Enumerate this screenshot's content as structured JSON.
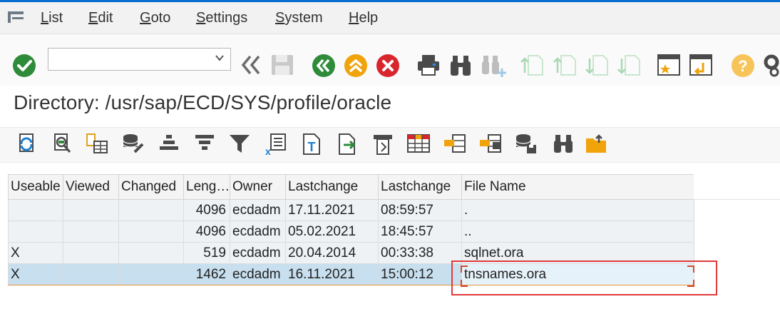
{
  "menu": {
    "items": [
      {
        "label": "List",
        "underline": "L",
        "rest": "ist"
      },
      {
        "label": "Edit",
        "underline": "E",
        "rest": "dit"
      },
      {
        "label": "Goto",
        "underline": "G",
        "rest": "oto"
      },
      {
        "label": "Settings",
        "underline": "S",
        "rest": "ettings"
      },
      {
        "label": "System",
        "underline": "S",
        "rest": "ystem"
      },
      {
        "label": "Help",
        "underline": "H",
        "rest": "elp"
      }
    ]
  },
  "command_field": {
    "value": "",
    "placeholder": ""
  },
  "title": "Directory: /usr/sap/ECD/SYS/profile/oracle",
  "table": {
    "headers": [
      "Useable",
      "Viewed",
      "Changed",
      "Leng…",
      "Owner",
      "Lastchange",
      "Lastchange",
      "File Name"
    ],
    "rows": [
      {
        "useable": "",
        "viewed": "",
        "changed": "",
        "length": "4096",
        "owner": "ecdadm",
        "date": "17.11.2021",
        "time": "08:59:57",
        "filename": "."
      },
      {
        "useable": "",
        "viewed": "",
        "changed": "",
        "length": "4096",
        "owner": "ecdadm",
        "date": "05.02.2021",
        "time": "18:45:57",
        "filename": ".."
      },
      {
        "useable": "X",
        "viewed": "",
        "changed": "",
        "length": "519",
        "owner": "ecdadm",
        "date": "20.04.2014",
        "time": "00:33:38",
        "filename": "sqlnet.ora"
      },
      {
        "useable": "X",
        "viewed": "",
        "changed": "",
        "length": "1462",
        "owner": "ecdadm",
        "date": "16.11.2021",
        "time": "15:00:12",
        "filename": "tnsnames.ora",
        "selected": true
      }
    ]
  },
  "colors": {
    "accent": "#0a6ed1",
    "ok_green": "#2e8b3a",
    "back_green": "#2e8b3a",
    "exit_orange": "#f0a30a",
    "cancel_red": "#d9262d",
    "highlight_red": "#e03a3a",
    "selected_row": "#c7dfee"
  }
}
